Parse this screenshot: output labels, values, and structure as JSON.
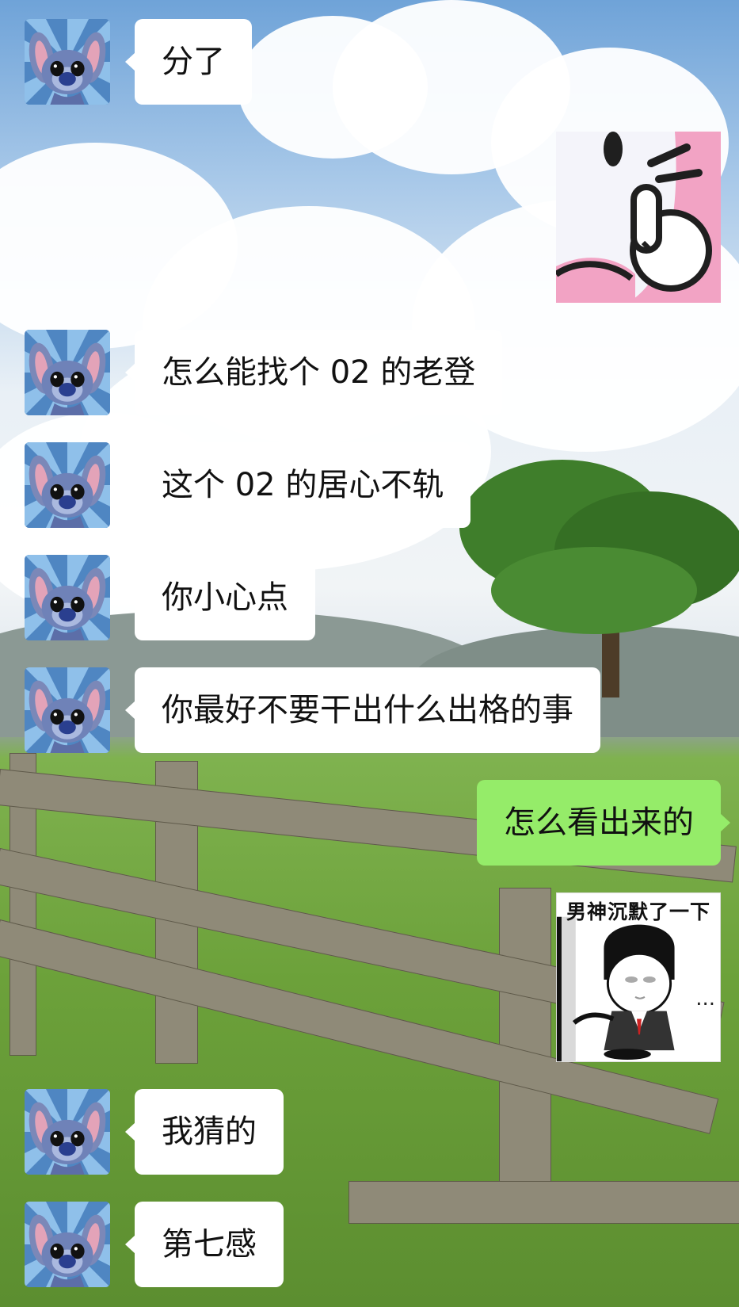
{
  "background_scene": "clouds-meadow-fence-tree",
  "colors": {
    "incoming_bubble": "#ffffff",
    "outgoing_bubble": "#95ec69",
    "text": "#111111"
  },
  "messages": [
    {
      "side": "left",
      "text": "分了",
      "avatar_icon": "stitch-avatar-icon"
    },
    {
      "side": "right",
      "type": "sticker",
      "sticker_icon": "middle-finger-sticker-icon"
    },
    {
      "side": "left",
      "text": "怎么能找个 02 的老登",
      "avatar_icon": "stitch-avatar-icon"
    },
    {
      "side": "left",
      "text": "这个 02 的居心不轨",
      "avatar_icon": "stitch-avatar-icon"
    },
    {
      "side": "left",
      "text": "你小心点",
      "avatar_icon": "stitch-avatar-icon"
    },
    {
      "side": "left",
      "text": "你最好不要干出什么出格的事",
      "avatar_icon": "stitch-avatar-icon"
    },
    {
      "side": "right",
      "text": "怎么看出来的"
    },
    {
      "side": "right",
      "type": "sticker",
      "sticker_icon": "silent-meme-sticker-icon",
      "caption": "男神沉默了一下",
      "dots": "..."
    },
    {
      "side": "left",
      "text": "我猜的",
      "avatar_icon": "stitch-avatar-icon"
    },
    {
      "side": "left",
      "text": "第七感",
      "avatar_icon": "stitch-avatar-icon"
    }
  ]
}
